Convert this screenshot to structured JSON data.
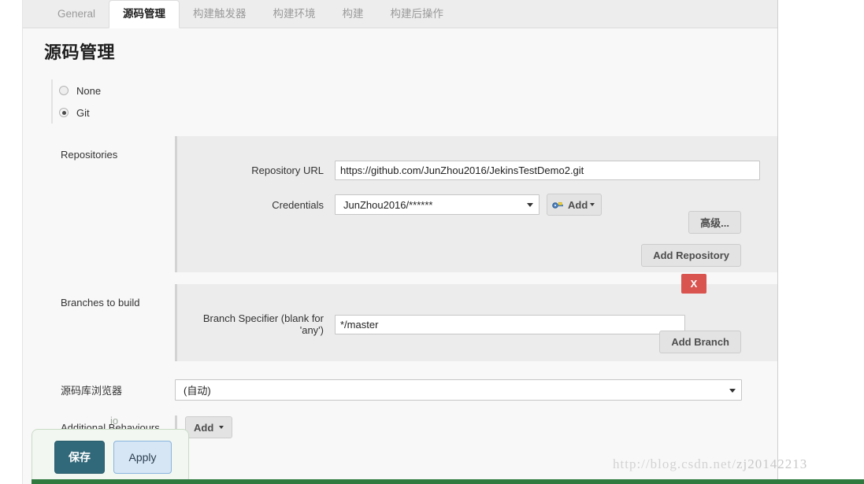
{
  "tabs": [
    {
      "label": "General",
      "active": false
    },
    {
      "label": "源码管理",
      "active": true
    },
    {
      "label": "构建触发器",
      "active": false
    },
    {
      "label": "构建环境",
      "active": false
    },
    {
      "label": "构建",
      "active": false
    },
    {
      "label": "构建后操作",
      "active": false
    }
  ],
  "page": {
    "title": "源码管理"
  },
  "scm": {
    "options": [
      {
        "label": "None",
        "selected": false
      },
      {
        "label": "Git",
        "selected": true
      }
    ]
  },
  "repositories": {
    "section_label": "Repositories",
    "repository_url": {
      "label": "Repository URL",
      "value": "https://github.com/JunZhou2016/JekinsTestDemo2.git"
    },
    "credentials": {
      "label": "Credentials",
      "value": "JunZhou2016/******",
      "add_button": "Add"
    },
    "advanced_button": "高级...",
    "add_repository_button": "Add Repository"
  },
  "branches": {
    "section_label": "Branches to build",
    "branch_specifier": {
      "label": "Branch Specifier (blank for 'any')",
      "value": "*/master"
    },
    "delete_button": "X",
    "add_branch_button": "Add Branch"
  },
  "repository_browser": {
    "label": "源码库浏览器",
    "value": "(自动)"
  },
  "additional_behaviours": {
    "label": "Additional Behaviours",
    "add_button": "Add"
  },
  "footer": {
    "save_button": "保存",
    "apply_button": "Apply",
    "obscured_text": "io"
  },
  "watermark": {
    "part_a": "http://blog.csdn.net/",
    "part_b": "zj20142213"
  },
  "colors": {
    "accent_save": "#31697a",
    "accent_apply": "#d6e6f5",
    "danger": "#d9534f",
    "help_icon": "#3a5e96",
    "panel_bg": "#f8f8f8",
    "inner_bg": "#ececec"
  },
  "icons": {
    "help": "help-icon",
    "key": "key-icon",
    "caret_down": "chevron-down-icon"
  }
}
